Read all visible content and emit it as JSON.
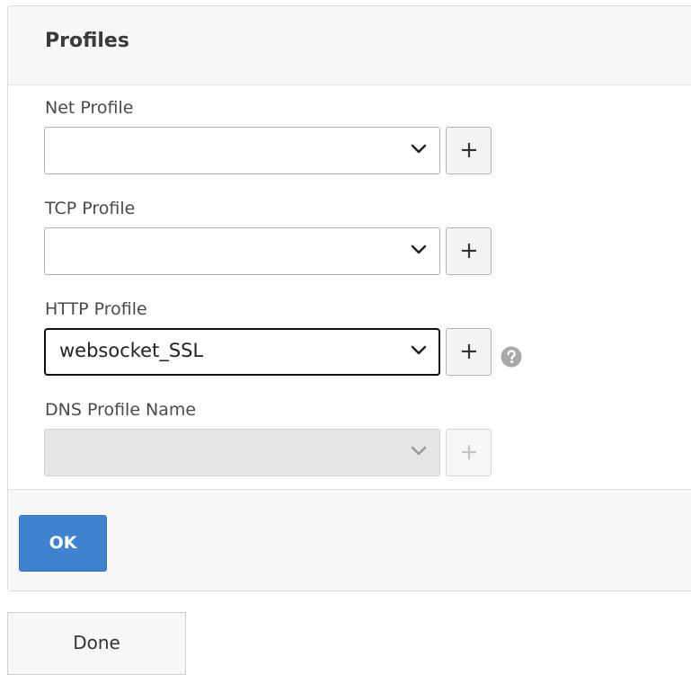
{
  "panel": {
    "title": "Profiles"
  },
  "fields": [
    {
      "label": "Net Profile",
      "value": "",
      "state": "enabled"
    },
    {
      "label": "TCP Profile",
      "value": "",
      "state": "enabled"
    },
    {
      "label": "HTTP Profile",
      "value": "websocket_SSL",
      "state": "focused"
    },
    {
      "label": "DNS Profile Name",
      "value": "",
      "state": "disabled"
    }
  ],
  "icons": {
    "dropdown": "chevron-down-icon",
    "add": "plus-icon",
    "help": "question-circle-icon"
  },
  "buttons": {
    "ok_label": "OK",
    "done_label": "Done"
  },
  "colors": {
    "primary": "#3f83cf",
    "help_icon": "#a9a9a9"
  }
}
